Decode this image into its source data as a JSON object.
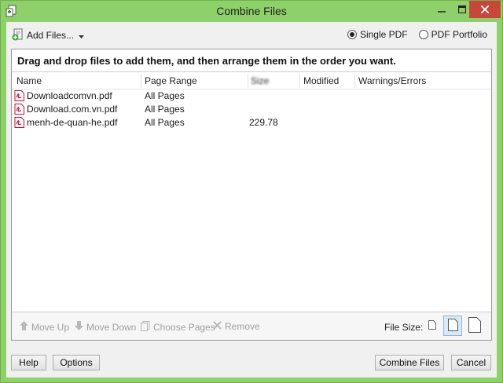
{
  "window": {
    "title": "Combine Files"
  },
  "toolbar": {
    "add_files_label": "Add Files...",
    "options": [
      {
        "label": "Single PDF",
        "selected": true
      },
      {
        "label": "PDF Portfolio",
        "selected": false
      }
    ]
  },
  "panel": {
    "instruction": "Drag and drop files to add them, and then arrange them in the order you want.",
    "columns": [
      "Name",
      "Page Range",
      "Size",
      "Modified",
      "Warnings/Errors"
    ],
    "files": [
      {
        "name": "Downloadcomvn.pdf",
        "page_range": "All Pages",
        "size": "",
        "modified": ""
      },
      {
        "name": "Download.com.vn.pdf",
        "page_range": "All Pages",
        "size": "",
        "modified": ""
      },
      {
        "name": "menh-de-quan-he.pdf",
        "page_range": "All Pages",
        "size": "229.78",
        "modified": ""
      }
    ]
  },
  "actions": {
    "move_up": "Move Up",
    "move_down": "Move Down",
    "choose_pages": "Choose Pages",
    "remove": "Remove",
    "file_size_label": "File Size:"
  },
  "buttons": {
    "help": "Help",
    "options": "Options",
    "combine": "Combine Files",
    "cancel": "Cancel"
  },
  "colors": {
    "frame": "#8ed16b",
    "close_button": "#c7473a",
    "pdf_icon": "#c8102e"
  }
}
